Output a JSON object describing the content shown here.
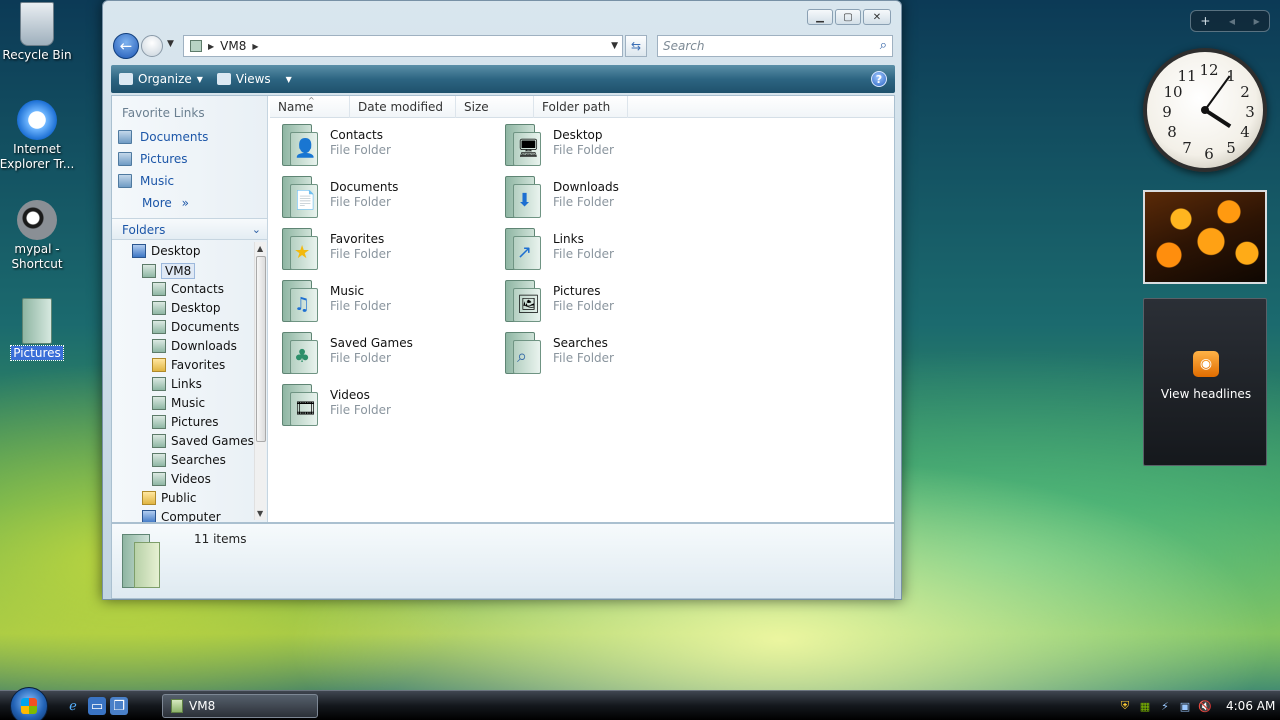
{
  "desktop": {
    "icons": [
      {
        "label": "Recycle Bin"
      },
      {
        "label": "Internet Explorer Tr..."
      },
      {
        "label": "mypal - Shortcut"
      },
      {
        "label": "Pictures"
      }
    ]
  },
  "window": {
    "address": {
      "segment": "VM8"
    },
    "search_placeholder": "Search",
    "toolbar": {
      "organize": "Organize",
      "views": "Views"
    },
    "nav": {
      "favorite_links_heading": "Favorite Links",
      "favorite_links": [
        "Documents",
        "Pictures",
        "Music"
      ],
      "more": "More",
      "folders_heading": "Folders",
      "tree": [
        {
          "label": "Desktop"
        },
        {
          "label": "VM8"
        },
        {
          "label": "Contacts"
        },
        {
          "label": "Desktop"
        },
        {
          "label": "Documents"
        },
        {
          "label": "Downloads"
        },
        {
          "label": "Favorites"
        },
        {
          "label": "Links"
        },
        {
          "label": "Music"
        },
        {
          "label": "Pictures"
        },
        {
          "label": "Saved Games"
        },
        {
          "label": "Searches"
        },
        {
          "label": "Videos"
        },
        {
          "label": "Public"
        },
        {
          "label": "Computer"
        }
      ]
    },
    "columns": [
      "Name",
      "Date modified",
      "Size",
      "Folder path"
    ],
    "files": [
      {
        "name": "Contacts",
        "type": "File Folder",
        "icon": "contacts-icon"
      },
      {
        "name": "Desktop",
        "type": "File Folder",
        "icon": "desktop-icon"
      },
      {
        "name": "Documents",
        "type": "File Folder",
        "icon": "documents-icon"
      },
      {
        "name": "Downloads",
        "type": "File Folder",
        "icon": "downloads-icon"
      },
      {
        "name": "Favorites",
        "type": "File Folder",
        "icon": "star-icon"
      },
      {
        "name": "Links",
        "type": "File Folder",
        "icon": "links-icon"
      },
      {
        "name": "Music",
        "type": "File Folder",
        "icon": "music-icon"
      },
      {
        "name": "Pictures",
        "type": "File Folder",
        "icon": "pictures-icon"
      },
      {
        "name": "Saved Games",
        "type": "File Folder",
        "icon": "games-icon"
      },
      {
        "name": "Searches",
        "type": "File Folder",
        "icon": "magnifier-icon"
      },
      {
        "name": "Videos",
        "type": "File Folder",
        "icon": "film-icon"
      }
    ],
    "details": {
      "count": "11 items"
    }
  },
  "sidebar": {
    "feed_text": "View headlines",
    "clock": {
      "hour": 4,
      "minute": 6
    }
  },
  "taskbar": {
    "task_label": "VM8",
    "time": "4:06 AM"
  },
  "colors": {
    "link_blue": "#1c56a8",
    "toolbar": "#2d6582",
    "selection": "#3a6ed8"
  }
}
